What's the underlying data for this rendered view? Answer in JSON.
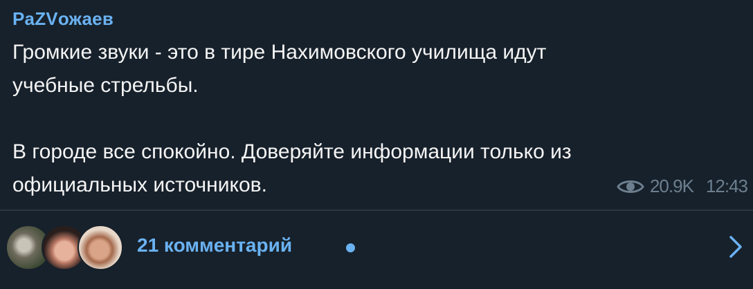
{
  "post": {
    "channel_name": "PaZVожаев",
    "text": "Громкие звуки - это в тире Нахимовского училища идут\nучебные стрельбы.\n\nВ городе все спокойно. Доверяйте информации только из\nофициальных источников.",
    "views": "20.9K",
    "time": "12:43",
    "icons": {
      "views": "eye-icon"
    }
  },
  "comments": {
    "label": "21 комментарий",
    "icons": {
      "open": "chevron-right-icon",
      "unread": "unread-dot"
    }
  },
  "colors": {
    "background": "#17212b",
    "accent": "#6ab2f2",
    "text": "#f5f5f5",
    "meta": "#6d7f8f"
  }
}
